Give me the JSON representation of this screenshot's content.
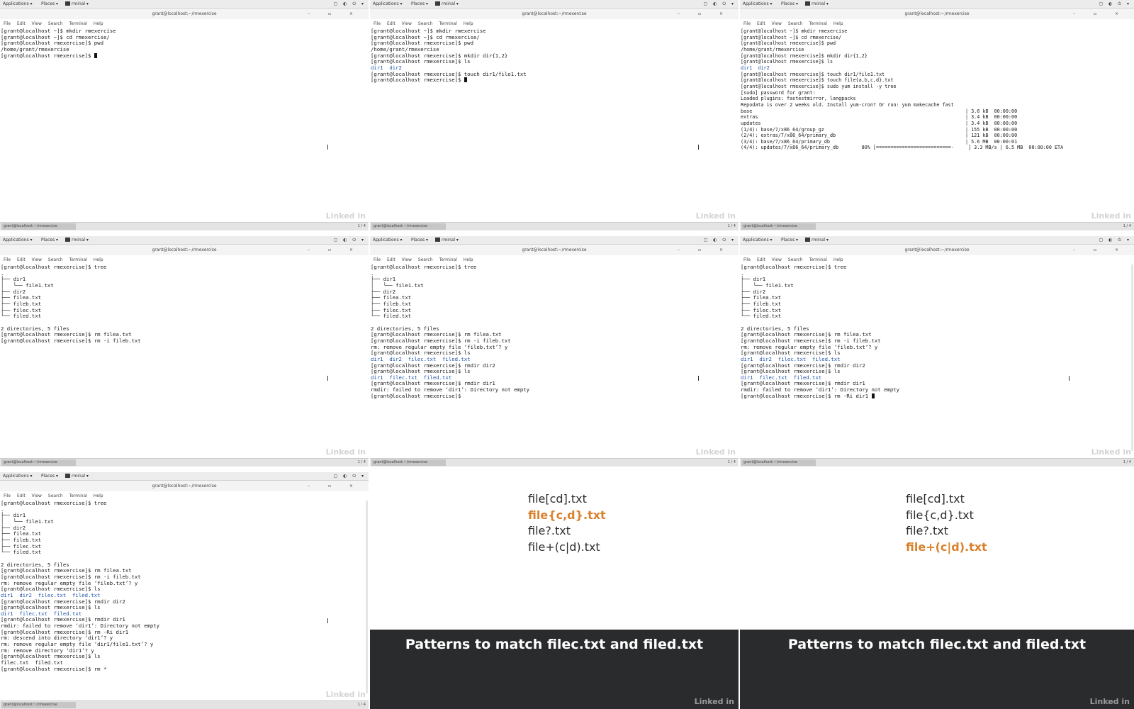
{
  "gnome": {
    "applications_label": "Applications ▾",
    "places_label": "Places ▾",
    "terminal_label": "rminal ▾",
    "tray": "▢ ◐ ⏻ ▾"
  },
  "window_title": "grant@localhost:~/rmexercise",
  "window_controls": "– ▫ ×",
  "terminal_menu": [
    "File",
    "Edit",
    "View",
    "Search",
    "Terminal",
    "Help"
  ],
  "taskbar": {
    "task": "grant@localhost:~/rmexercise",
    "workspace": "1 / 4"
  },
  "watermark": "Linked in",
  "terminals": [
    {
      "lines": [
        "[grant@localhost ~]$ mkdir rmexercise",
        "[grant@localhost ~]$ cd rmexercise/",
        "[grant@localhost rmexercise]$ pwd",
        "/home/grant/rmexercise",
        "[grant@localhost rmexercise]$ "
      ]
    },
    {
      "lines": [
        "[grant@localhost ~]$ mkdir rmexercise",
        "[grant@localhost ~]$ cd rmexercise/",
        "[grant@localhost rmexercise]$ pwd",
        "/home/grant/rmexercise",
        "[grant@localhost rmexercise]$ mkdir dir{1,2}",
        "[grant@localhost rmexercise]$ ls",
        "dir1  dir2",
        "[grant@localhost rmexercise]$ touch dir1/file1.txt",
        "[grant@localhost rmexercise]$ "
      ]
    },
    {
      "lines": [
        "[grant@localhost ~]$ mkdir rmexercise",
        "[grant@localhost ~]$ cd rmexercise/",
        "[grant@localhost rmexercise]$ pwd",
        "/home/grant/rmexercise",
        "[grant@localhost rmexercise]$ mkdir dir{1,2}",
        "[grant@localhost rmexercise]$ ls",
        "dir1  dir2",
        "[grant@localhost rmexercise]$ touch dir1/file1.txt",
        "[grant@localhost rmexercise]$ touch file{a,b,c,d}.txt",
        "[grant@localhost rmexercise]$ sudo yum install -y tree",
        "[sudo] password for grant:",
        "Loaded plugins: fastestmirror, langpacks",
        "Repodata is over 2 weeks old. Install yum-cron? Or run: yum makecache fast",
        "base                                                                          | 3.6 kB  00:00:00",
        "extras                                                                        | 3.4 kB  00:00:00",
        "updates                                                                       | 3.4 kB  00:00:00",
        "(1/4): base/7/x86_64/group_gz                                                 | 155 kB  00:00:00",
        "(2/4): extras/7/x86_64/primary_db                                             | 121 kB  00:00:00",
        "(3/4): base/7/x86_64/primary_db                                               | 5.6 MB  00:00:01",
        "(4/4): updates/7/x86_64/primary_db        80% [==========================-     ] 3.3 MB/s | 6.5 MB  00:00:00 ETA"
      ]
    },
    {
      "lines": [
        "[grant@localhost rmexercise]$ tree",
        ".",
        "├── dir1",
        "│   └── file1.txt",
        "├── dir2",
        "├── filea.txt",
        "├── fileb.txt",
        "├── filec.txt",
        "└── filed.txt",
        "",
        "2 directories, 5 files",
        "[grant@localhost rmexercise]$ rm filea.txt",
        "[grant@localhost rmexercise]$ rm -i fileb.txt"
      ]
    },
    {
      "lines": [
        "[grant@localhost rmexercise]$ tree",
        ".",
        "├── dir1",
        "│   └── file1.txt",
        "├── dir2",
        "├── filea.txt",
        "├── fileb.txt",
        "├── filec.txt",
        "└── filed.txt",
        "",
        "2 directories, 5 files",
        "[grant@localhost rmexercise]$ rm filea.txt",
        "[grant@localhost rmexercise]$ rm -i fileb.txt",
        "rm: remove regular empty file ‘fileb.txt’? y",
        "[grant@localhost rmexercise]$ ls",
        "dir1  dir2  filec.txt  filed.txt",
        "[grant@localhost rmexercise]$ rmdir dir2",
        "[grant@localhost rmexercise]$ ls",
        "dir1  filec.txt  filed.txt",
        "[grant@localhost rmexercise]$ rmdir dir1",
        "rmdir: failed to remove ‘dir1’: Directory not empty",
        "[grant@localhost rmexercise]$ "
      ]
    },
    {
      "lines": [
        "[grant@localhost rmexercise]$ tree",
        ".",
        "├── dir1",
        "│   └── file1.txt",
        "├── dir2",
        "├── filea.txt",
        "├── fileb.txt",
        "├── filec.txt",
        "└── filed.txt",
        "",
        "2 directories, 5 files",
        "[grant@localhost rmexercise]$ rm filea.txt",
        "[grant@localhost rmexercise]$ rm -i fileb.txt",
        "rm: remove regular empty file ‘fileb.txt’? y",
        "[grant@localhost rmexercise]$ ls",
        "dir1  dir2  filec.txt  filed.txt",
        "[grant@localhost rmexercise]$ rmdir dir2",
        "[grant@localhost rmexercise]$ ls",
        "dir1  filec.txt  filed.txt",
        "[grant@localhost rmexercise]$ rmdir dir1",
        "rmdir: failed to remove ‘dir1’: Directory not empty",
        "[grant@localhost rmexercise]$ rm -Ri dir1 "
      ]
    },
    {
      "lines": [
        "[grant@localhost rmexercise]$ tree",
        ".",
        "├── dir1",
        "│   └── file1.txt",
        "├── dir2",
        "├── filea.txt",
        "├── fileb.txt",
        "├── filec.txt",
        "└── filed.txt",
        "",
        "2 directories, 5 files",
        "[grant@localhost rmexercise]$ rm filea.txt",
        "[grant@localhost rmexercise]$ rm -i fileb.txt",
        "rm: remove regular empty file ‘fileb.txt’? y",
        "[grant@localhost rmexercise]$ ls",
        "dir1  dir2  filec.txt  filed.txt",
        "[grant@localhost rmexercise]$ rmdir dir2",
        "[grant@localhost rmexercise]$ ls",
        "dir1  filec.txt  filed.txt",
        "[grant@localhost rmexercise]$ rmdir dir1",
        "rmdir: failed to remove ‘dir1’: Directory not empty",
        "[grant@localhost rmexercise]$ rm -Ri dir1",
        "rm: descend into directory ‘dir1’? y",
        "rm: remove regular empty file ‘dir1/file1.txt’? y",
        "rm: remove directory ‘dir1’? y",
        "[grant@localhost rmexercise]$ ls",
        "filec.txt  filed.txt",
        "[grant@localhost rmexercise]$ rm *"
      ]
    }
  ],
  "slides": [
    {
      "patterns": [
        "file[cd].txt",
        "file{c,d}.txt",
        "file?.txt",
        "file+(c|d).txt"
      ],
      "highlight_index": 1,
      "caption": "Patterns to match filec.txt and filed.txt"
    },
    {
      "patterns": [
        "file[cd].txt",
        "file{c,d}.txt",
        "file?.txt",
        "file+(c|d).txt"
      ],
      "highlight_index": 3,
      "caption": "Patterns to match filec.txt and filed.txt"
    }
  ],
  "colors": {
    "highlight": "#d9812b",
    "caption_band": "#2a2b2d",
    "ls_dir": "#2255aa"
  }
}
